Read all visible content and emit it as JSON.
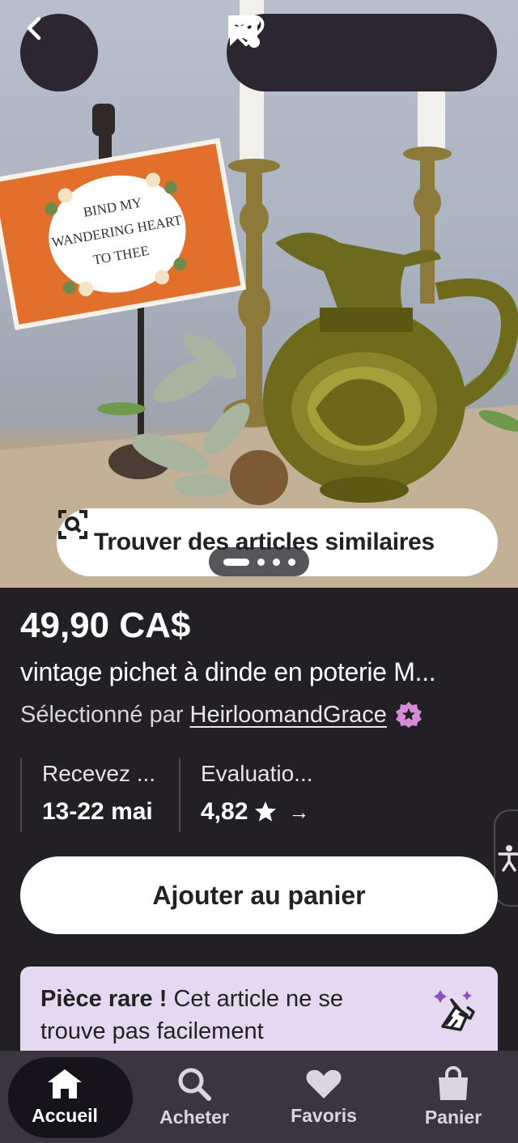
{
  "listing": {
    "price": "49,90 CA$",
    "title": "vintage pichet à dinde en poterie M...",
    "selected_by_prefix": "Sélectionné par",
    "seller": "HeirloomandGrace"
  },
  "hero": {
    "find_similar_label": "Trouver des articles similaires",
    "sign_text": [
      "BIND MY",
      "WANDERING HEART",
      "TO THEE"
    ]
  },
  "info": {
    "delivery_label": "Recevez ...",
    "delivery_value": "13-22 mai",
    "rating_label": "Evaluatio...",
    "rating_value": "4,82",
    "rating_arrow": "→"
  },
  "actions": {
    "add_to_cart": "Ajouter au panier"
  },
  "rare": {
    "bold": "Pièce rare !",
    "text": " Cet article ne se trouve pas facilement"
  },
  "nav": {
    "items": [
      {
        "label": "Accueil",
        "icon": "home-icon",
        "active": true
      },
      {
        "label": "Acheter",
        "icon": "search-icon",
        "active": false
      },
      {
        "label": "Favoris",
        "icon": "heart-icon",
        "active": false
      },
      {
        "label": "Panier",
        "icon": "bag-icon",
        "active": false
      }
    ]
  },
  "colors": {
    "background": "#222024",
    "button_bg": "#ffffff",
    "rare_bg": "#e4d9f1",
    "nav_bg": "#3a3640",
    "star_badge": "#d58bd6"
  }
}
